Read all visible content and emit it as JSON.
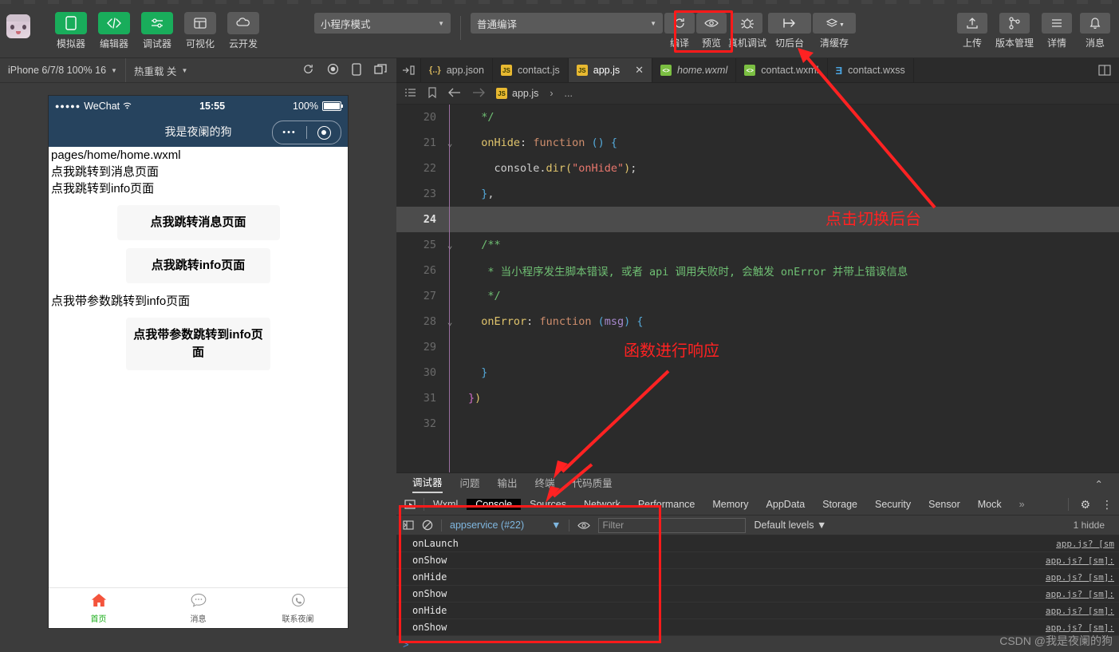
{
  "toolbar": {
    "left_tools": [
      {
        "label": "模拟器",
        "icon": "phone-icon",
        "style": "green"
      },
      {
        "label": "编辑器",
        "icon": "code-icon",
        "style": "green"
      },
      {
        "label": "调试器",
        "icon": "sliders-icon",
        "style": "green"
      },
      {
        "label": "可视化",
        "icon": "layout-icon",
        "style": "grey"
      },
      {
        "label": "云开发",
        "icon": "cloud-icon",
        "style": "grey"
      }
    ],
    "mode_select": "小程序模式",
    "compile_select": "普通编译",
    "actions": [
      {
        "label": "编译",
        "icon": "refresh-icon"
      },
      {
        "label": "预览",
        "icon": "eye-icon"
      },
      {
        "label": "真机调试",
        "icon": "bug-icon"
      },
      {
        "label": "切后台",
        "icon": "background-switch-icon"
      },
      {
        "label": "清缓存",
        "icon": "layers-icon"
      }
    ],
    "right_actions": [
      {
        "label": "上传",
        "icon": "upload-icon"
      },
      {
        "label": "版本管理",
        "icon": "branch-icon"
      },
      {
        "label": "详情",
        "icon": "menu-icon"
      },
      {
        "label": "消息",
        "icon": "bell-icon"
      }
    ]
  },
  "simulator": {
    "device": "iPhone 6/7/8 100% 16",
    "hot_reload": "热重载 关",
    "statusbar": {
      "carrier": "WeChat",
      "time": "15:55",
      "battery": "100%"
    },
    "nav_title": "我是夜阑的狗",
    "page": {
      "path_text": "pages/home/home.wxml",
      "line2": "点我跳转到消息页面",
      "line3": "点我跳转到info页面",
      "button1": "点我跳转消息页面",
      "button2": "点我跳转info页面",
      "line4": "点我带参数跳转到info页面",
      "button3": "点我带参数跳转到info页面"
    },
    "tabbar": [
      {
        "label": "首页",
        "icon": "home-icon",
        "active": true
      },
      {
        "label": "消息",
        "icon": "chat-icon",
        "active": false
      },
      {
        "label": "联系夜阑",
        "icon": "phone-call-icon",
        "active": false
      }
    ]
  },
  "editor": {
    "tabs": [
      {
        "label": "app.json",
        "kind": "json",
        "active": false,
        "italic": false
      },
      {
        "label": "contact.js",
        "kind": "js",
        "active": false,
        "italic": false
      },
      {
        "label": "app.js",
        "kind": "js",
        "active": true,
        "italic": false,
        "closable": true
      },
      {
        "label": "home.wxml",
        "kind": "wxml",
        "active": false,
        "italic": true
      },
      {
        "label": "contact.wxml",
        "kind": "wxml",
        "active": false,
        "italic": false
      },
      {
        "label": "contact.wxss",
        "kind": "wxss",
        "active": false,
        "italic": false
      }
    ],
    "close_glyph": "✕",
    "breadcrumb": {
      "file": "app.js",
      "trail": "..."
    },
    "lines": [
      {
        "num": "20",
        "fold": "",
        "highlight": false,
        "tokens": [
          {
            "t": "  */",
            "c": "c-com"
          }
        ]
      },
      {
        "num": "21",
        "fold": "⌄",
        "highlight": false,
        "tokens": [
          {
            "t": "  ",
            "c": "c-plain"
          },
          {
            "t": "onHide",
            "c": "c-prop"
          },
          {
            "t": ": ",
            "c": "c-plain"
          },
          {
            "t": "function",
            "c": "c-key"
          },
          {
            "t": " ",
            "c": "c-plain"
          },
          {
            "t": "()",
            "c": "c-par"
          },
          {
            "t": " ",
            "c": "c-plain"
          },
          {
            "t": "{",
            "c": "c-par"
          }
        ]
      },
      {
        "num": "22",
        "fold": "",
        "highlight": false,
        "tokens": [
          {
            "t": "    console",
            "c": "c-plain"
          },
          {
            "t": ".",
            "c": "c-plain"
          },
          {
            "t": "dir",
            "c": "c-fn"
          },
          {
            "t": "(",
            "c": "c-yel"
          },
          {
            "t": "\"onHide\"",
            "c": "c-str"
          },
          {
            "t": ")",
            "c": "c-yel"
          },
          {
            "t": ";",
            "c": "c-plain"
          }
        ]
      },
      {
        "num": "23",
        "fold": "",
        "highlight": false,
        "tokens": [
          {
            "t": "  ",
            "c": "c-plain"
          },
          {
            "t": "}",
            "c": "c-par"
          },
          {
            "t": ",",
            "c": "c-plain"
          }
        ]
      },
      {
        "num": "24",
        "fold": "",
        "highlight": true,
        "tokens": [
          {
            "t": "",
            "c": "c-plain"
          }
        ]
      },
      {
        "num": "25",
        "fold": "⌄",
        "highlight": false,
        "tokens": [
          {
            "t": "  /**",
            "c": "c-com"
          }
        ]
      },
      {
        "num": "26",
        "fold": "",
        "highlight": false,
        "tokens": [
          {
            "t": "   * 当小程序发生脚本错误, 或者 api 调用失败时, 会触发 onError 并带上错误信息",
            "c": "c-com"
          }
        ]
      },
      {
        "num": "27",
        "fold": "",
        "highlight": false,
        "tokens": [
          {
            "t": "   */",
            "c": "c-com"
          }
        ]
      },
      {
        "num": "28",
        "fold": "⌄",
        "highlight": false,
        "tokens": [
          {
            "t": "  ",
            "c": "c-plain"
          },
          {
            "t": "onError",
            "c": "c-prop"
          },
          {
            "t": ": ",
            "c": "c-plain"
          },
          {
            "t": "function",
            "c": "c-key"
          },
          {
            "t": " ",
            "c": "c-plain"
          },
          {
            "t": "(",
            "c": "c-par"
          },
          {
            "t": "msg",
            "c": "c-var"
          },
          {
            "t": ")",
            "c": "c-par"
          },
          {
            "t": " ",
            "c": "c-plain"
          },
          {
            "t": "{",
            "c": "c-par"
          }
        ]
      },
      {
        "num": "29",
        "fold": "",
        "highlight": false,
        "tokens": [
          {
            "t": "",
            "c": "c-plain"
          }
        ]
      },
      {
        "num": "30",
        "fold": "",
        "highlight": false,
        "tokens": [
          {
            "t": "  ",
            "c": "c-plain"
          },
          {
            "t": "}",
            "c": "c-par"
          }
        ]
      },
      {
        "num": "31",
        "fold": "",
        "highlight": false,
        "tokens": [
          {
            "t": "}",
            "c": "c-pink"
          },
          {
            "t": ")",
            "c": "c-yel"
          }
        ]
      },
      {
        "num": "32",
        "fold": "",
        "highlight": false,
        "tokens": [
          {
            "t": "",
            "c": "c-plain"
          }
        ]
      }
    ]
  },
  "devtools": {
    "panel_tabs": [
      {
        "label": "调试器",
        "active": true
      },
      {
        "label": "问题",
        "active": false
      },
      {
        "label": "输出",
        "active": false
      },
      {
        "label": "终端",
        "active": false
      },
      {
        "label": "代码质量",
        "active": false
      }
    ],
    "collapse_glyph": "⌃",
    "dev_tabs": [
      {
        "label": "Wxml",
        "active": false
      },
      {
        "label": "Console",
        "active": true
      },
      {
        "label": "Sources",
        "active": false
      },
      {
        "label": "Network",
        "active": false
      },
      {
        "label": "Performance",
        "active": false
      },
      {
        "label": "Memory",
        "active": false
      },
      {
        "label": "AppData",
        "active": false
      },
      {
        "label": "Storage",
        "active": false
      },
      {
        "label": "Security",
        "active": false
      },
      {
        "label": "Sensor",
        "active": false
      },
      {
        "label": "Mock",
        "active": false
      }
    ],
    "more_glyph": "»",
    "console_bar": {
      "context": "appservice (#22)",
      "filter_placeholder": "Filter",
      "levels": "Default levels",
      "hidden_note": "1 hidde"
    },
    "console_rows": [
      {
        "text": "onLaunch",
        "source": "app.js? [sm"
      },
      {
        "text": "onShow",
        "source": "app.js? [sm]:"
      },
      {
        "text": "onHide",
        "source": "app.js? [sm]:"
      },
      {
        "text": "onShow",
        "source": "app.js? [sm]:"
      },
      {
        "text": "onHide",
        "source": "app.js? [sm]:"
      },
      {
        "text": "onShow",
        "source": "app.js? [sm]:"
      }
    ],
    "prompt_glyph": ">"
  },
  "annotations": {
    "note1": "点击切换后台",
    "note2": "函数进行响应",
    "watermark": "CSDN @我是夜阑的狗",
    "accent_red": "#ff1a1a"
  }
}
